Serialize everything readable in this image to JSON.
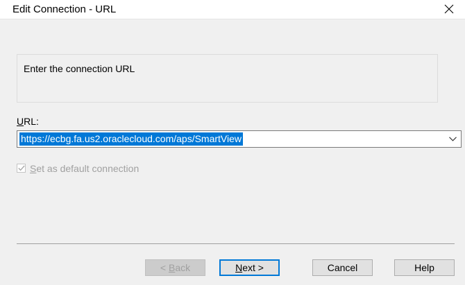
{
  "window": {
    "title": "Edit Connection - URL",
    "close_icon": "close-icon"
  },
  "instruction": {
    "text": "Enter the connection URL"
  },
  "url_field": {
    "label_mnemonic": "U",
    "label_rest": "RL:",
    "value": "https://ecbg.fa.us2.oraclecloud.com/aps/SmartView",
    "dropdown_icon": "chevron-down-icon"
  },
  "default_checkbox": {
    "checked": true,
    "enabled": false,
    "label_mnemonic": "S",
    "label_rest": "et as default connection"
  },
  "buttons": {
    "back": {
      "prefix": "< ",
      "mnemonic": "B",
      "rest": "ack",
      "enabled": false
    },
    "next": {
      "mnemonic": "N",
      "rest": "ext >",
      "default": true
    },
    "cancel": {
      "label": "Cancel"
    },
    "help": {
      "label": "Help"
    }
  },
  "colors": {
    "dialog_bg": "#f0f0f0",
    "selection": "#0078d7",
    "disabled_text": "#a0a0a0"
  }
}
